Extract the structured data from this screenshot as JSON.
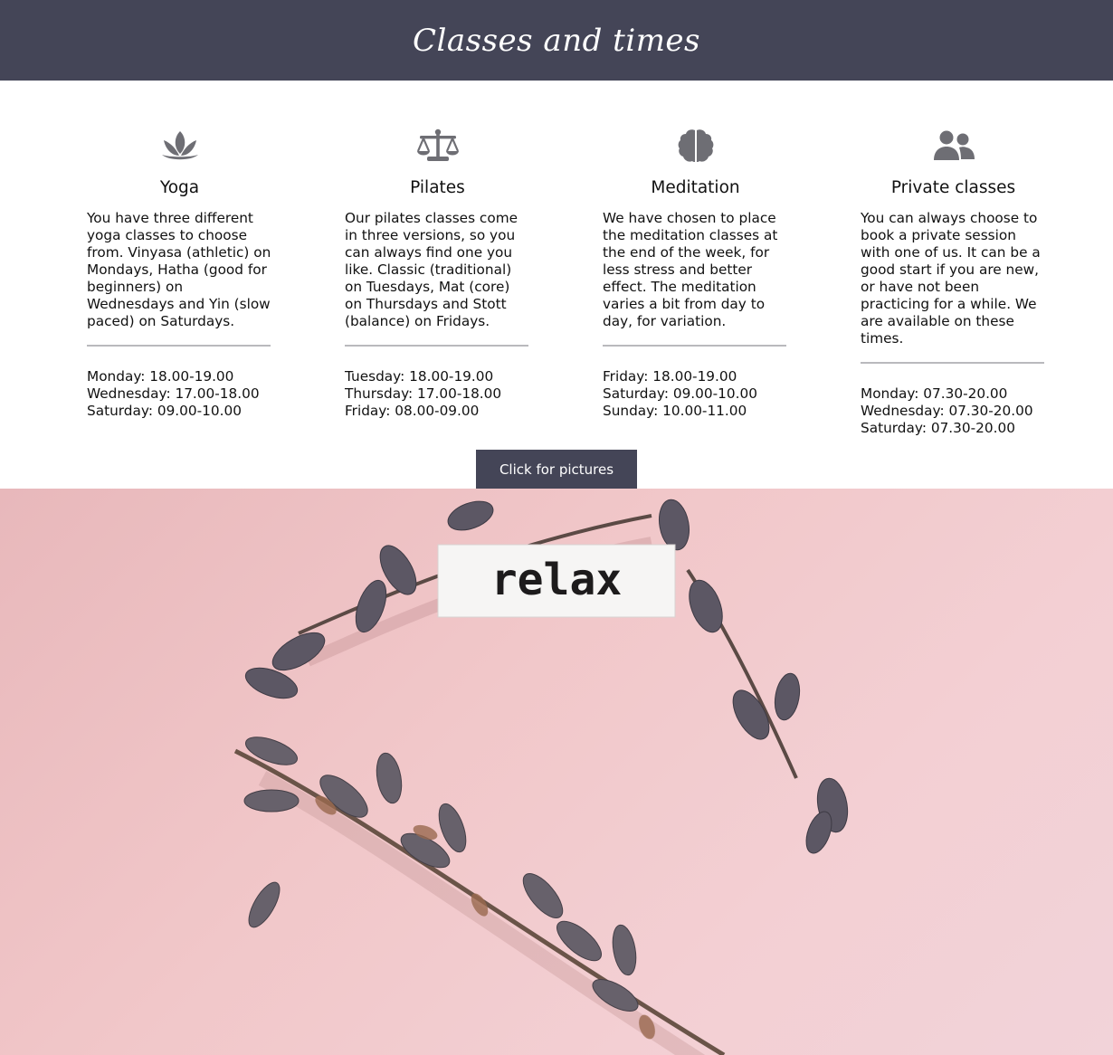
{
  "header": {
    "title": "Classes and times"
  },
  "classes": [
    {
      "icon": "lotus-icon",
      "title": "Yoga",
      "description": "You have three different yoga classes to choose from. Vinyasa (athletic) on Mondays, Hatha (good for beginners) on Wednesdays and Yin (slow paced) on Saturdays.",
      "times": [
        "Monday: 18.00-19.00",
        "Wednesday: 17.00-18.00",
        "Saturday: 09.00-10.00"
      ]
    },
    {
      "icon": "balance-scale-icon",
      "title": "Pilates",
      "description": "Our pilates classes come in three versions, so you can always find one you like. Classic (traditional) on Tuesdays, Mat (core) on Thursdays and Stott (balance) on Fridays.",
      "times": [
        "Tuesday: 18.00-19.00",
        "Thursday: 17.00-18.00",
        "Friday: 08.00-09.00"
      ]
    },
    {
      "icon": "brain-icon",
      "title": "Meditation",
      "description": "We have chosen to place the meditation classes at the end of the week, for less stress and better effect. The meditation varies a bit from day to day, for variation.",
      "times": [
        "Friday: 18.00-19.00",
        "Saturday: 09.00-10.00",
        "Sunday: 10.00-11.00"
      ]
    },
    {
      "icon": "users-icon",
      "title": "Private classes",
      "description": "You can always choose to book a private session with one of us. It can be a good start if you are new, or have not been practicing for a while. We are available on these times.",
      "times": [
        "Monday: 07.30-20.00",
        "Wednesday: 07.30-20.00",
        "Saturday: 07.30-20.00"
      ]
    }
  ],
  "button": {
    "label": "Click for pictures"
  },
  "photo": {
    "tag_text": "relax"
  },
  "colors": {
    "header_bg": "#444557",
    "icon": "#6e6e74",
    "divider": "#b9b9bd"
  }
}
